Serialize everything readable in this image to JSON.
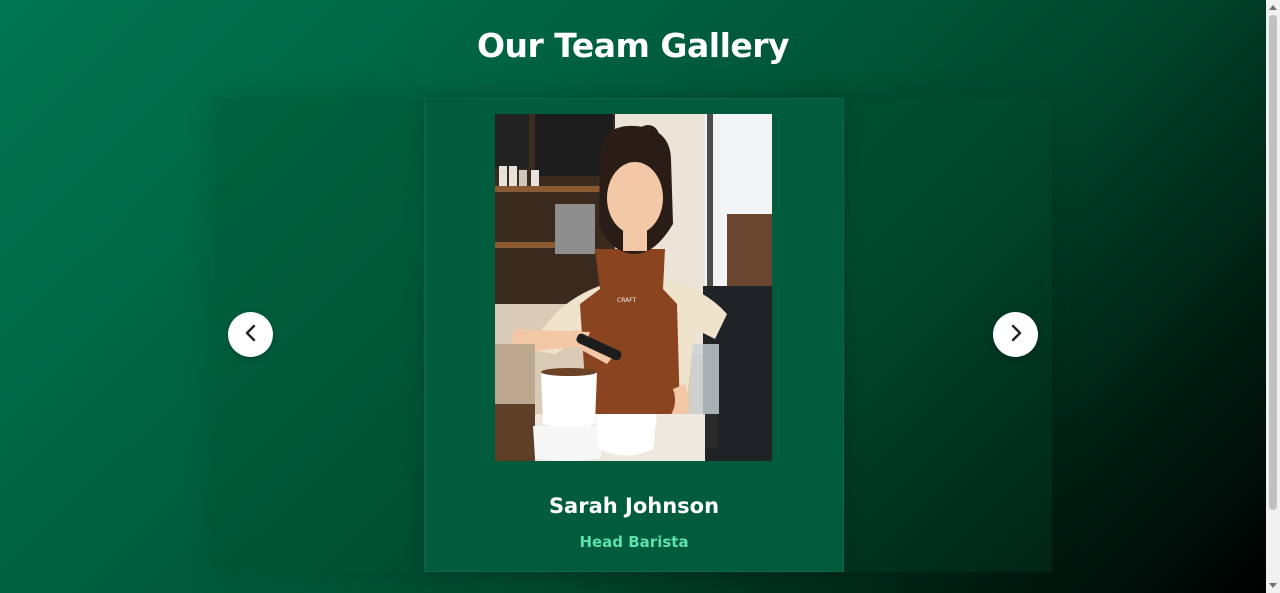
{
  "page": {
    "title": "Our Team Gallery"
  },
  "gallery": {
    "current": {
      "name": "Sarah Johnson",
      "role": "Head Barista",
      "apron_text": "CRAFT"
    },
    "prev_icon": "chevron-left-icon",
    "next_icon": "chevron-right-icon"
  },
  "colors": {
    "background_start": "#007650",
    "background_end": "#000000",
    "card": "#005c3c",
    "role_accent": "#5ee0ae",
    "button": "#ffffff"
  }
}
